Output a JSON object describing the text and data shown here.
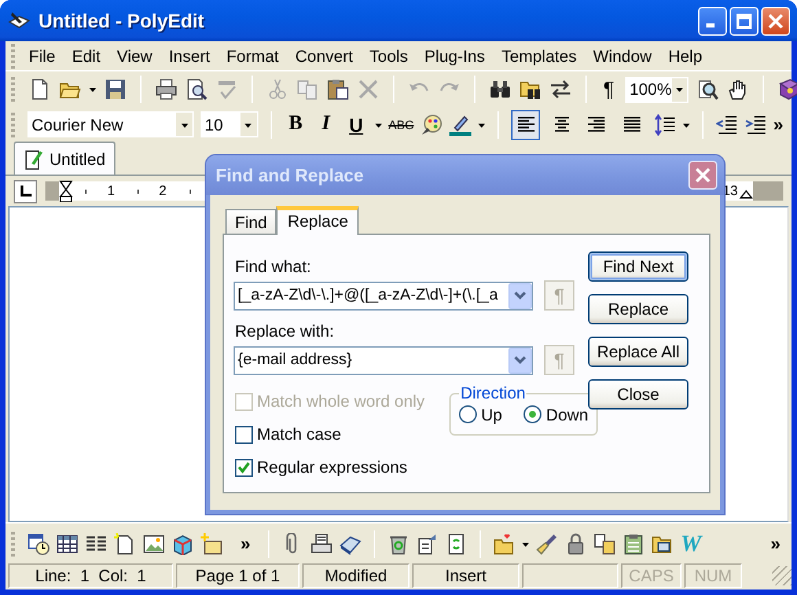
{
  "window": {
    "title": "Untitled - PolyEdit"
  },
  "menu": [
    "File",
    "Edit",
    "View",
    "Insert",
    "Format",
    "Convert",
    "Tools",
    "Plug-Ins",
    "Templates",
    "Window",
    "Help"
  ],
  "standard_toolbar": {
    "pilcrow": "¶",
    "zoom": "100%"
  },
  "format_toolbar": {
    "font": "Courier New",
    "size": "10",
    "styles": [
      "B",
      "I",
      "U"
    ],
    "strike": "ABC",
    "overflow": "»",
    "alignment": [
      {
        "selected": true
      },
      {
        "selected": false
      },
      {
        "selected": false
      },
      {
        "selected": false
      }
    ]
  },
  "document_tabs": [
    {
      "label": "Untitled",
      "selected": true
    }
  ],
  "ruler": {
    "marks": [
      "1",
      "2",
      "13"
    ]
  },
  "dialog": {
    "title": "Find and Replace",
    "tabs": [
      {
        "label": "Find",
        "selected": false
      },
      {
        "label": "Replace",
        "selected": true
      }
    ],
    "find_label": "Find what:",
    "find_value": "[_a-zA-Z\\d\\-\\.]+@([_a-zA-Z\\d\\-]+(\\.[_a",
    "find_special": "¶",
    "replace_label": "Replace with:",
    "replace_value": "{e-mail address}",
    "replace_special": "¶",
    "options": [
      {
        "label": "Match whole word only",
        "checked": false,
        "disabled": true
      },
      {
        "label": "Match case",
        "checked": false,
        "disabled": false
      },
      {
        "label": "Regular expressions",
        "checked": true,
        "disabled": false
      }
    ],
    "direction": {
      "title": "Direction",
      "options": [
        {
          "label": "Up",
          "selected": false
        },
        {
          "label": "Down",
          "selected": true
        }
      ]
    },
    "buttons": [
      {
        "label": "Find Next",
        "default": true
      },
      {
        "label": "Replace",
        "default": false
      },
      {
        "label": "Replace All",
        "default": false
      },
      {
        "label": "Close",
        "default": false
      }
    ]
  },
  "bottom_toolbar": {
    "overflow": [
      "»",
      "»"
    ],
    "logo": "W"
  },
  "status_bar": [
    {
      "kind": "text",
      "text": "Line:  1  Col:  1",
      "disabled": false
    },
    {
      "kind": "text",
      "text": "Page 1 of 1",
      "disabled": false
    },
    {
      "kind": "text",
      "text": "Modified",
      "disabled": false
    },
    {
      "kind": "text",
      "text": "Insert",
      "disabled": false
    },
    {
      "kind": "blank"
    },
    {
      "kind": "text",
      "text": "CAPS",
      "disabled": true
    },
    {
      "kind": "text",
      "text": "NUM",
      "disabled": true
    }
  ]
}
